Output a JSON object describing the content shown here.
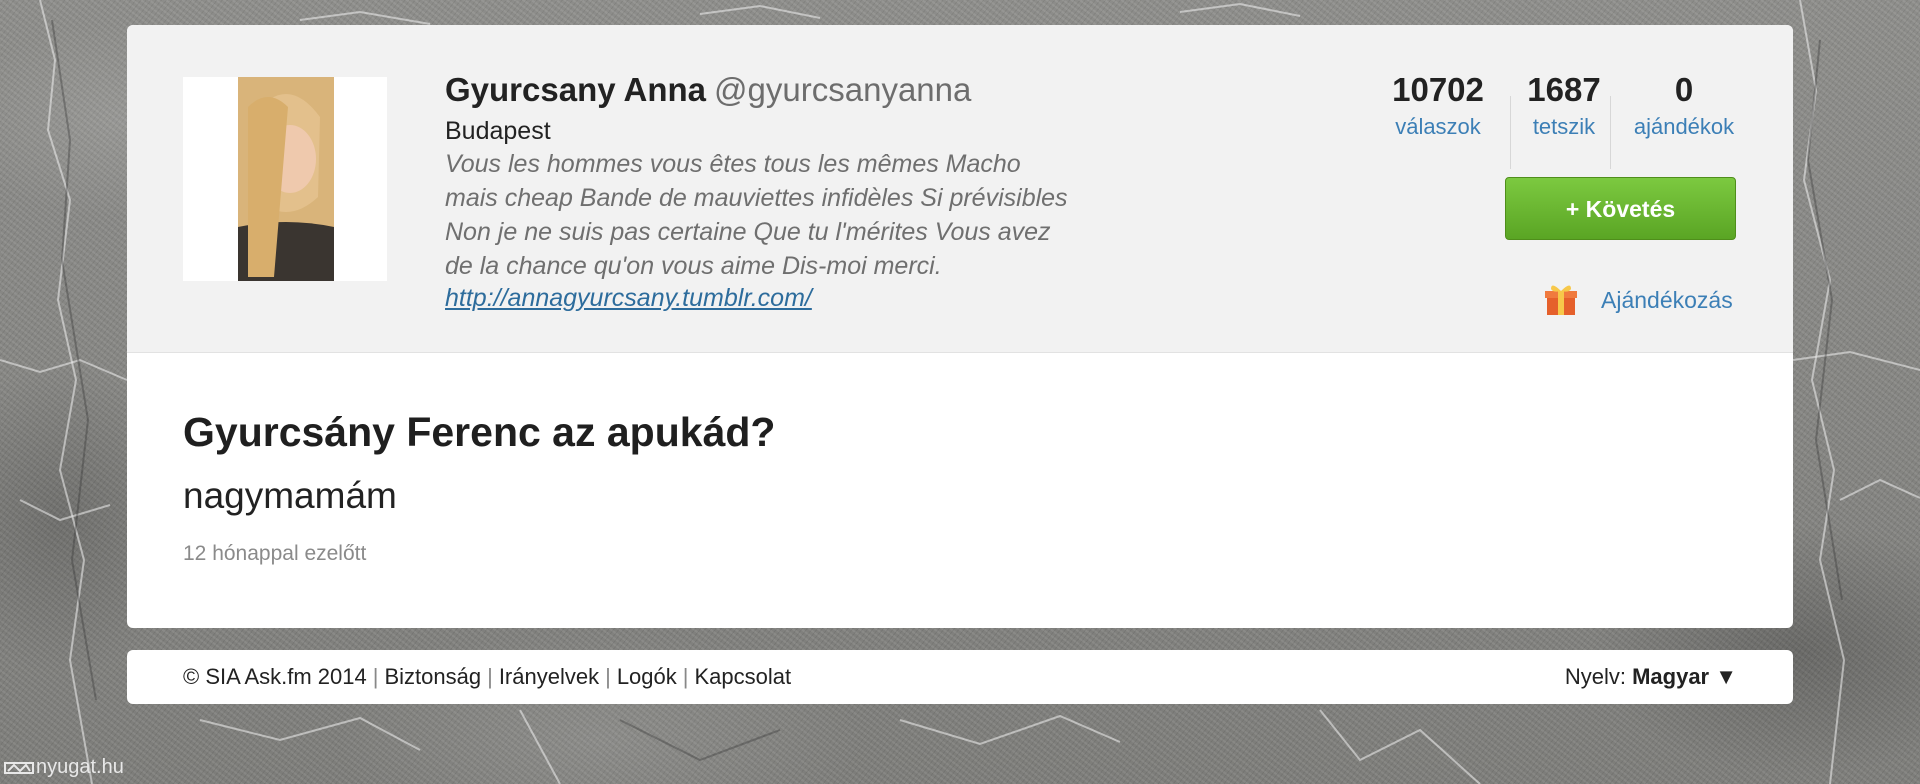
{
  "profile": {
    "name": "Gyurcsany Anna",
    "handle": "@gyurcsanyanna",
    "location": "Budapest",
    "bio_lines": [
      "Vous les hommes vous êtes tous les mêmes Macho",
      "mais cheap Bande de mauviettes infidèles Si prévisibles",
      "Non je ne suis pas certaine Que tu l'mérites Vous avez",
      "de la chance qu'on vous aime Dis-moi merci."
    ],
    "link": "http://annagyurcsany.tumblr.com/"
  },
  "stats": [
    {
      "value": "10702",
      "label": "válaszok"
    },
    {
      "value": "1687",
      "label": "tetszik"
    },
    {
      "value": "0",
      "label": "ajándékok"
    }
  ],
  "actions": {
    "follow_label": "+ Követés",
    "gift_label": "Ajándékozás",
    "gift_icon": "gift-icon"
  },
  "post": {
    "question": "Gyurcsány Ferenc az apukád?",
    "answer": "nagymamám",
    "time": "12 hónappal ezelőtt"
  },
  "footer": {
    "copyright": "© SIA Ask.fm 2014",
    "links": [
      "Biztonság",
      "Irányelvek",
      "Logók",
      "Kapcsolat"
    ],
    "language_label": "Nyelv:",
    "language_value": "Magyar ▼"
  },
  "watermark": "nyugat.hu",
  "colors": {
    "link": "#3c7fb6",
    "follow_button": "#6bb732",
    "background": "#8a8a88"
  }
}
